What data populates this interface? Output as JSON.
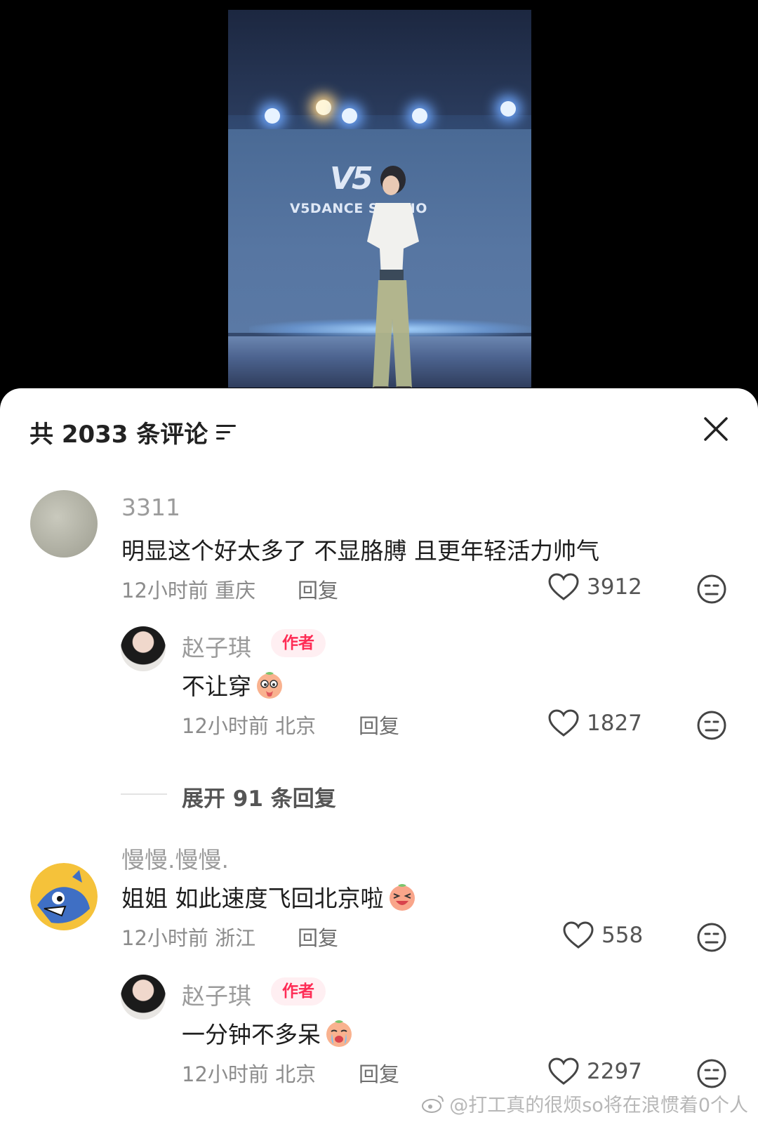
{
  "video": {
    "logo": "V5",
    "studio_text": "V5DANCE STUDIO"
  },
  "comments_panel": {
    "title": "共 2033 条评论",
    "sort_icon": "sort-icon",
    "close_icon": "close-icon"
  },
  "comments": [
    {
      "username": "3311",
      "text": "明显这个好太多了 不显胳膊 且更年轻活力帅气",
      "meta": "12小时前 重庆",
      "reply_label": "回复",
      "likes": "3912",
      "reply": {
        "username": "赵子琪",
        "badge": "作者",
        "text": "不让穿",
        "meta": "12小时前 北京",
        "reply_label": "回复",
        "likes": "1827"
      },
      "expand_label": "展开 91 条回复"
    },
    {
      "username": "慢慢.慢慢.",
      "text": "姐姐 如此速度飞回北京啦",
      "meta": "12小时前 浙江",
      "reply_label": "回复",
      "likes": "558",
      "reply": {
        "username": "赵子琪",
        "badge": "作者",
        "text": "一分钟不多呆",
        "meta": "12小时前 北京",
        "reply_label": "回复",
        "likes": "2297"
      }
    }
  ],
  "watermark": "@打工真的很烦so将在浪惯着0个人",
  "colors": {
    "author_badge_text": "#fe2c55",
    "author_badge_bg": "#ffeff2"
  }
}
